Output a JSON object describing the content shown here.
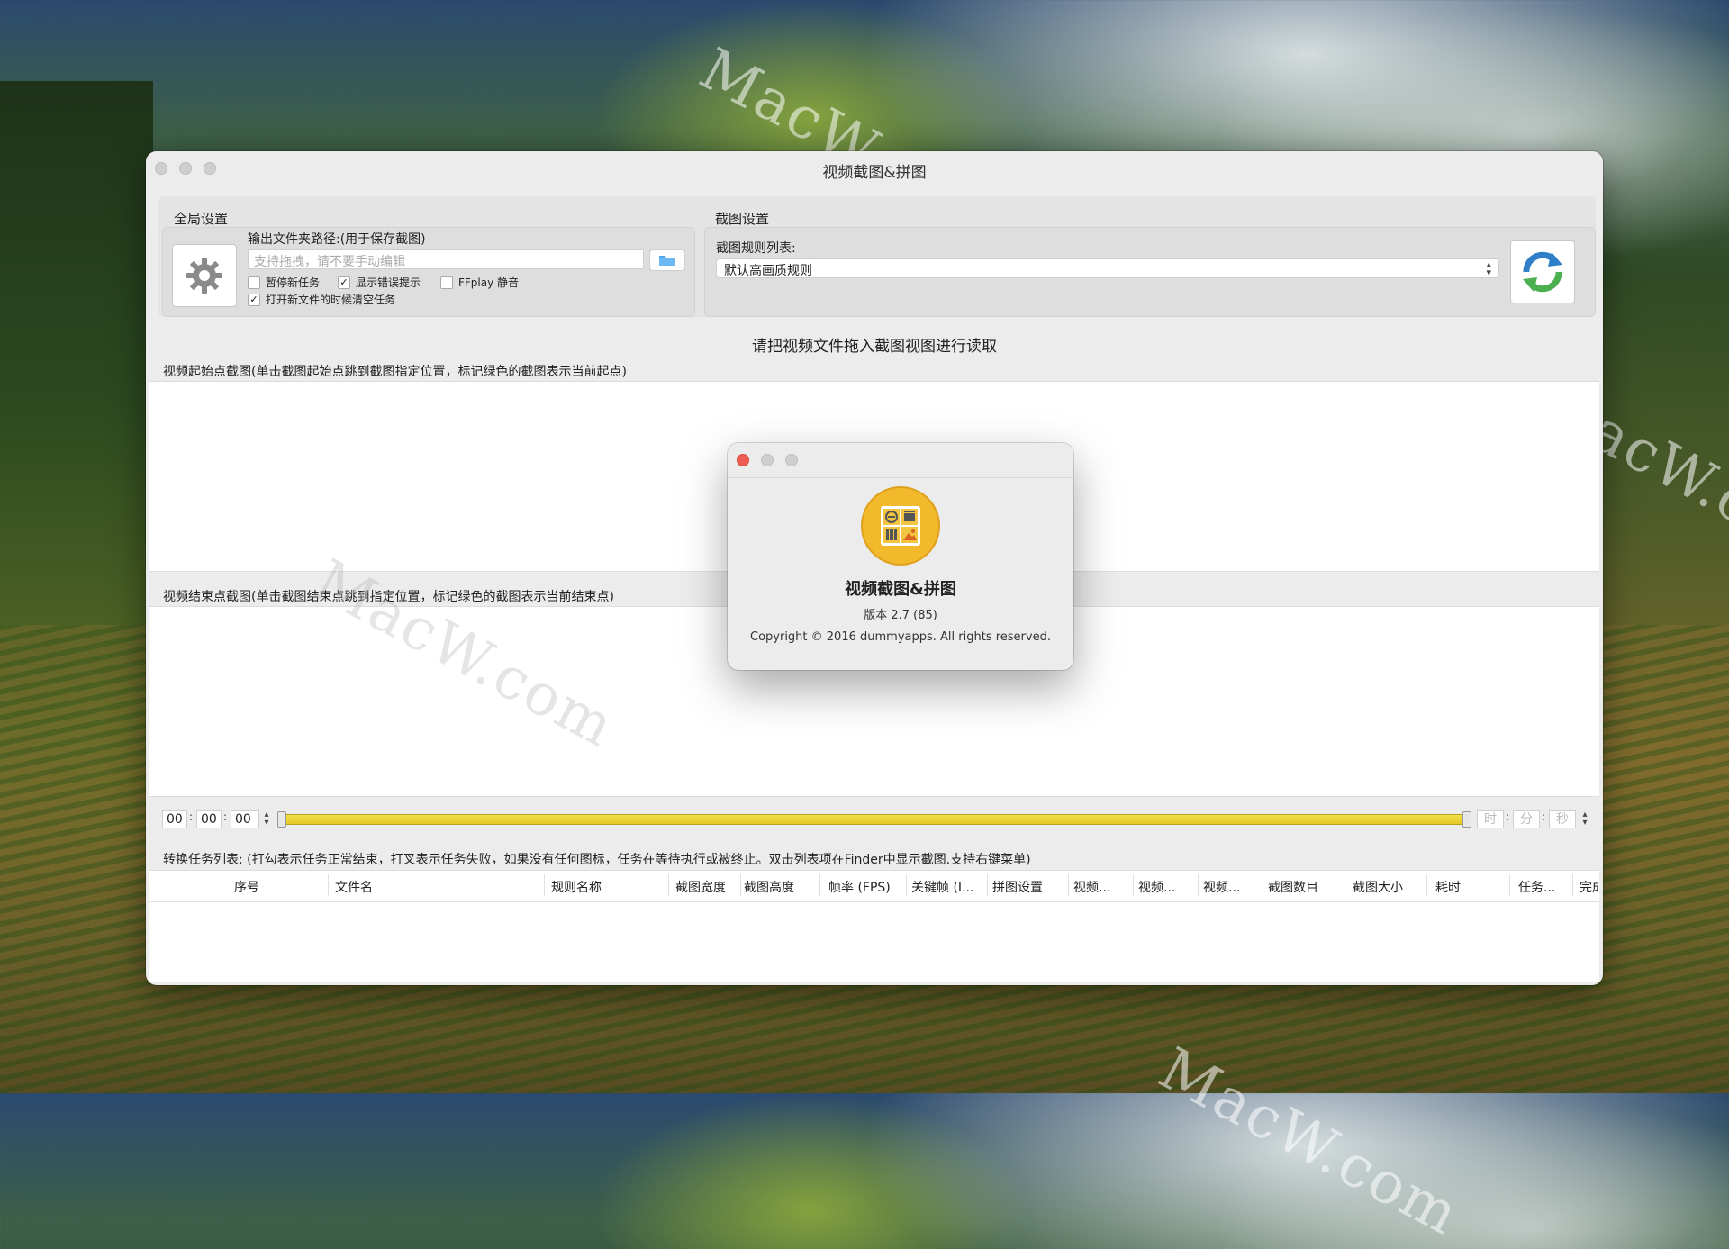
{
  "window": {
    "title": "视频截图&拼图"
  },
  "global_settings": {
    "section_label": "全局设置",
    "output_label": "输出文件夹路径:(用于保存截图)",
    "output_placeholder": "支持拖拽，请不要手动编辑",
    "checkboxes": [
      {
        "label": "暂停新任务",
        "checked": false
      },
      {
        "label": "显示错误提示",
        "checked": true
      },
      {
        "label": "FFplay 静音",
        "checked": false
      },
      {
        "label": "打开新文件的时候清空任务",
        "checked": true
      }
    ]
  },
  "screenshot_settings": {
    "section_label": "截图设置",
    "rules_label": "截图规则列表:",
    "selected_rule": "默认高画质规则"
  },
  "main": {
    "instruction": "请把视频文件拖入截图视图进行读取",
    "start_header": "视频起始点截图(单击截图起始点跳到截图指定位置，标记绿色的截图表示当前起点)",
    "end_header": "视频结束点截图(单击截图结束点跳到指定位置，标记绿色的截图表示当前结束点)"
  },
  "timeline": {
    "start_h": "00",
    "start_m": "00",
    "start_s": "00",
    "end_h_placeholder": "时",
    "end_m_placeholder": "分",
    "end_s_placeholder": "秒"
  },
  "tasks": {
    "header": "转换任务列表: (打勾表示任务正常结束，打叉表示任务失败，如果没有任何图标，任务在等待执行或被终止。双击列表项在Finder中显示截图.支持右键菜单)",
    "columns": [
      "序号",
      "文件名",
      "规则名称",
      "截图宽度",
      "截图高度",
      "帧率 (FPS)",
      "关键帧 (I...",
      "拼图设置",
      "视频...",
      "视频...",
      "视频...",
      "截图数目",
      "截图大小",
      "耗时",
      "任务...",
      "完成"
    ]
  },
  "about": {
    "app_name": "视频截图&拼图",
    "version": "版本 2.7 (85)",
    "copyright": "Copyright © 2016 dummyapps. All rights reserved."
  },
  "watermarks": [
    "MacW.com",
    "MacW.com",
    "MacW.com",
    "MacW.com"
  ],
  "colors": {
    "slider": "#e9cf2c",
    "close_red": "#ee5c53",
    "icon_gold": "#f2b92c"
  }
}
